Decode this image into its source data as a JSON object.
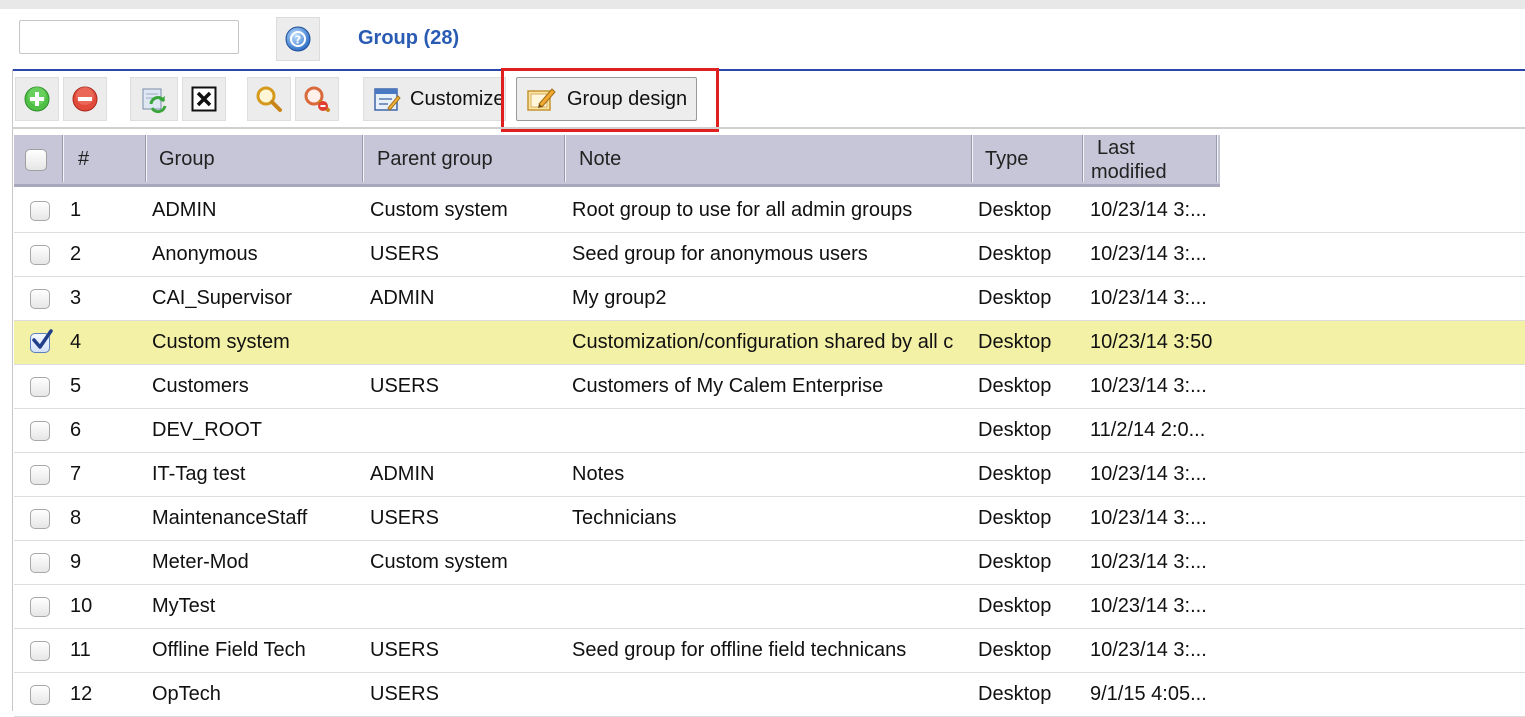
{
  "search": {
    "value": "",
    "placeholder": ""
  },
  "title": "Group (28)",
  "toolbar": {
    "customize_label": "Customize",
    "group_design_label": "Group design"
  },
  "columns": {
    "num": "#",
    "group": "Group",
    "parent": "Parent group",
    "note": "Note",
    "type": "Type",
    "modified_line1": "Last",
    "modified_line2": "modified"
  },
  "rows": [
    {
      "num": "1",
      "group": "ADMIN",
      "parent": "Custom system",
      "note": "Root group to use for all admin groups",
      "type": "Desktop",
      "modified": "10/23/14 3:...",
      "checked": false
    },
    {
      "num": "2",
      "group": "Anonymous",
      "parent": "USERS",
      "note": "Seed group for anonymous users",
      "type": "Desktop",
      "modified": "10/23/14 3:...",
      "checked": false
    },
    {
      "num": "3",
      "group": "CAI_Supervisor",
      "parent": "ADMIN",
      "note": "My group2",
      "type": "Desktop",
      "modified": "10/23/14 3:...",
      "checked": false
    },
    {
      "num": "4",
      "group": "Custom system",
      "parent": "",
      "note": "Customization/configuration shared by all c",
      "type": "Desktop",
      "modified": "10/23/14 3:50",
      "checked": true
    },
    {
      "num": "5",
      "group": "Customers",
      "parent": "USERS",
      "note": "Customers of My Calem Enterprise",
      "type": "Desktop",
      "modified": "10/23/14 3:...",
      "checked": false
    },
    {
      "num": "6",
      "group": "DEV_ROOT",
      "parent": "",
      "note": "",
      "type": "Desktop",
      "modified": "11/2/14 2:0...",
      "checked": false
    },
    {
      "num": "7",
      "group": "IT-Tag test",
      "parent": "ADMIN",
      "note": "Notes",
      "type": "Desktop",
      "modified": "10/23/14 3:...",
      "checked": false
    },
    {
      "num": "8",
      "group": "MaintenanceStaff",
      "parent": "USERS",
      "note": "Technicians",
      "type": "Desktop",
      "modified": "10/23/14 3:...",
      "checked": false
    },
    {
      "num": "9",
      "group": "Meter-Mod",
      "parent": "Custom system",
      "note": "",
      "type": "Desktop",
      "modified": "10/23/14 3:...",
      "checked": false
    },
    {
      "num": "10",
      "group": "MyTest",
      "parent": "",
      "note": "",
      "type": "Desktop",
      "modified": "10/23/14 3:...",
      "checked": false
    },
    {
      "num": "11",
      "group": "Offline Field Tech",
      "parent": "USERS",
      "note": "Seed group for offline field technicans",
      "type": "Desktop",
      "modified": "10/23/14 3:...",
      "checked": false
    },
    {
      "num": "12",
      "group": "OpTech",
      "parent": "USERS",
      "note": "",
      "type": "Desktop",
      "modified": "9/1/15 4:05...",
      "checked": false
    }
  ],
  "colors": {
    "title_blue": "#2a5bb3",
    "header_bg": "#c6c6d8",
    "selected_row": "#f3f1a6",
    "highlight_red": "#e02020"
  }
}
